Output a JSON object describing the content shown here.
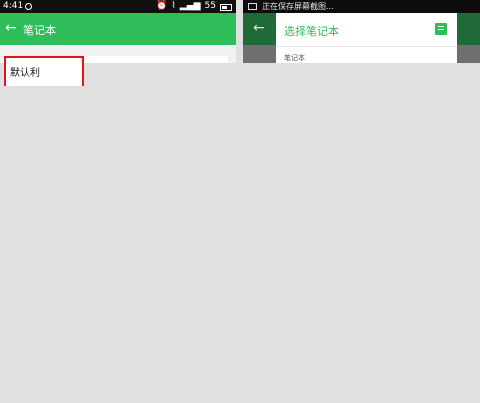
{
  "left": {
    "status": {
      "time": "4:41",
      "signal_text": "55"
    },
    "app_bar": {
      "title": "笔记本"
    },
    "notebook": {
      "label": "默认利"
    }
  },
  "right": {
    "status": {
      "text": "正在保存屏幕截图..."
    },
    "dialog": {
      "title": "选择笔记本",
      "section_label": "笔记本"
    }
  },
  "colors": {
    "accent": "#2ebd59",
    "highlight": "#e0161b",
    "background": "#e0e0e0"
  }
}
